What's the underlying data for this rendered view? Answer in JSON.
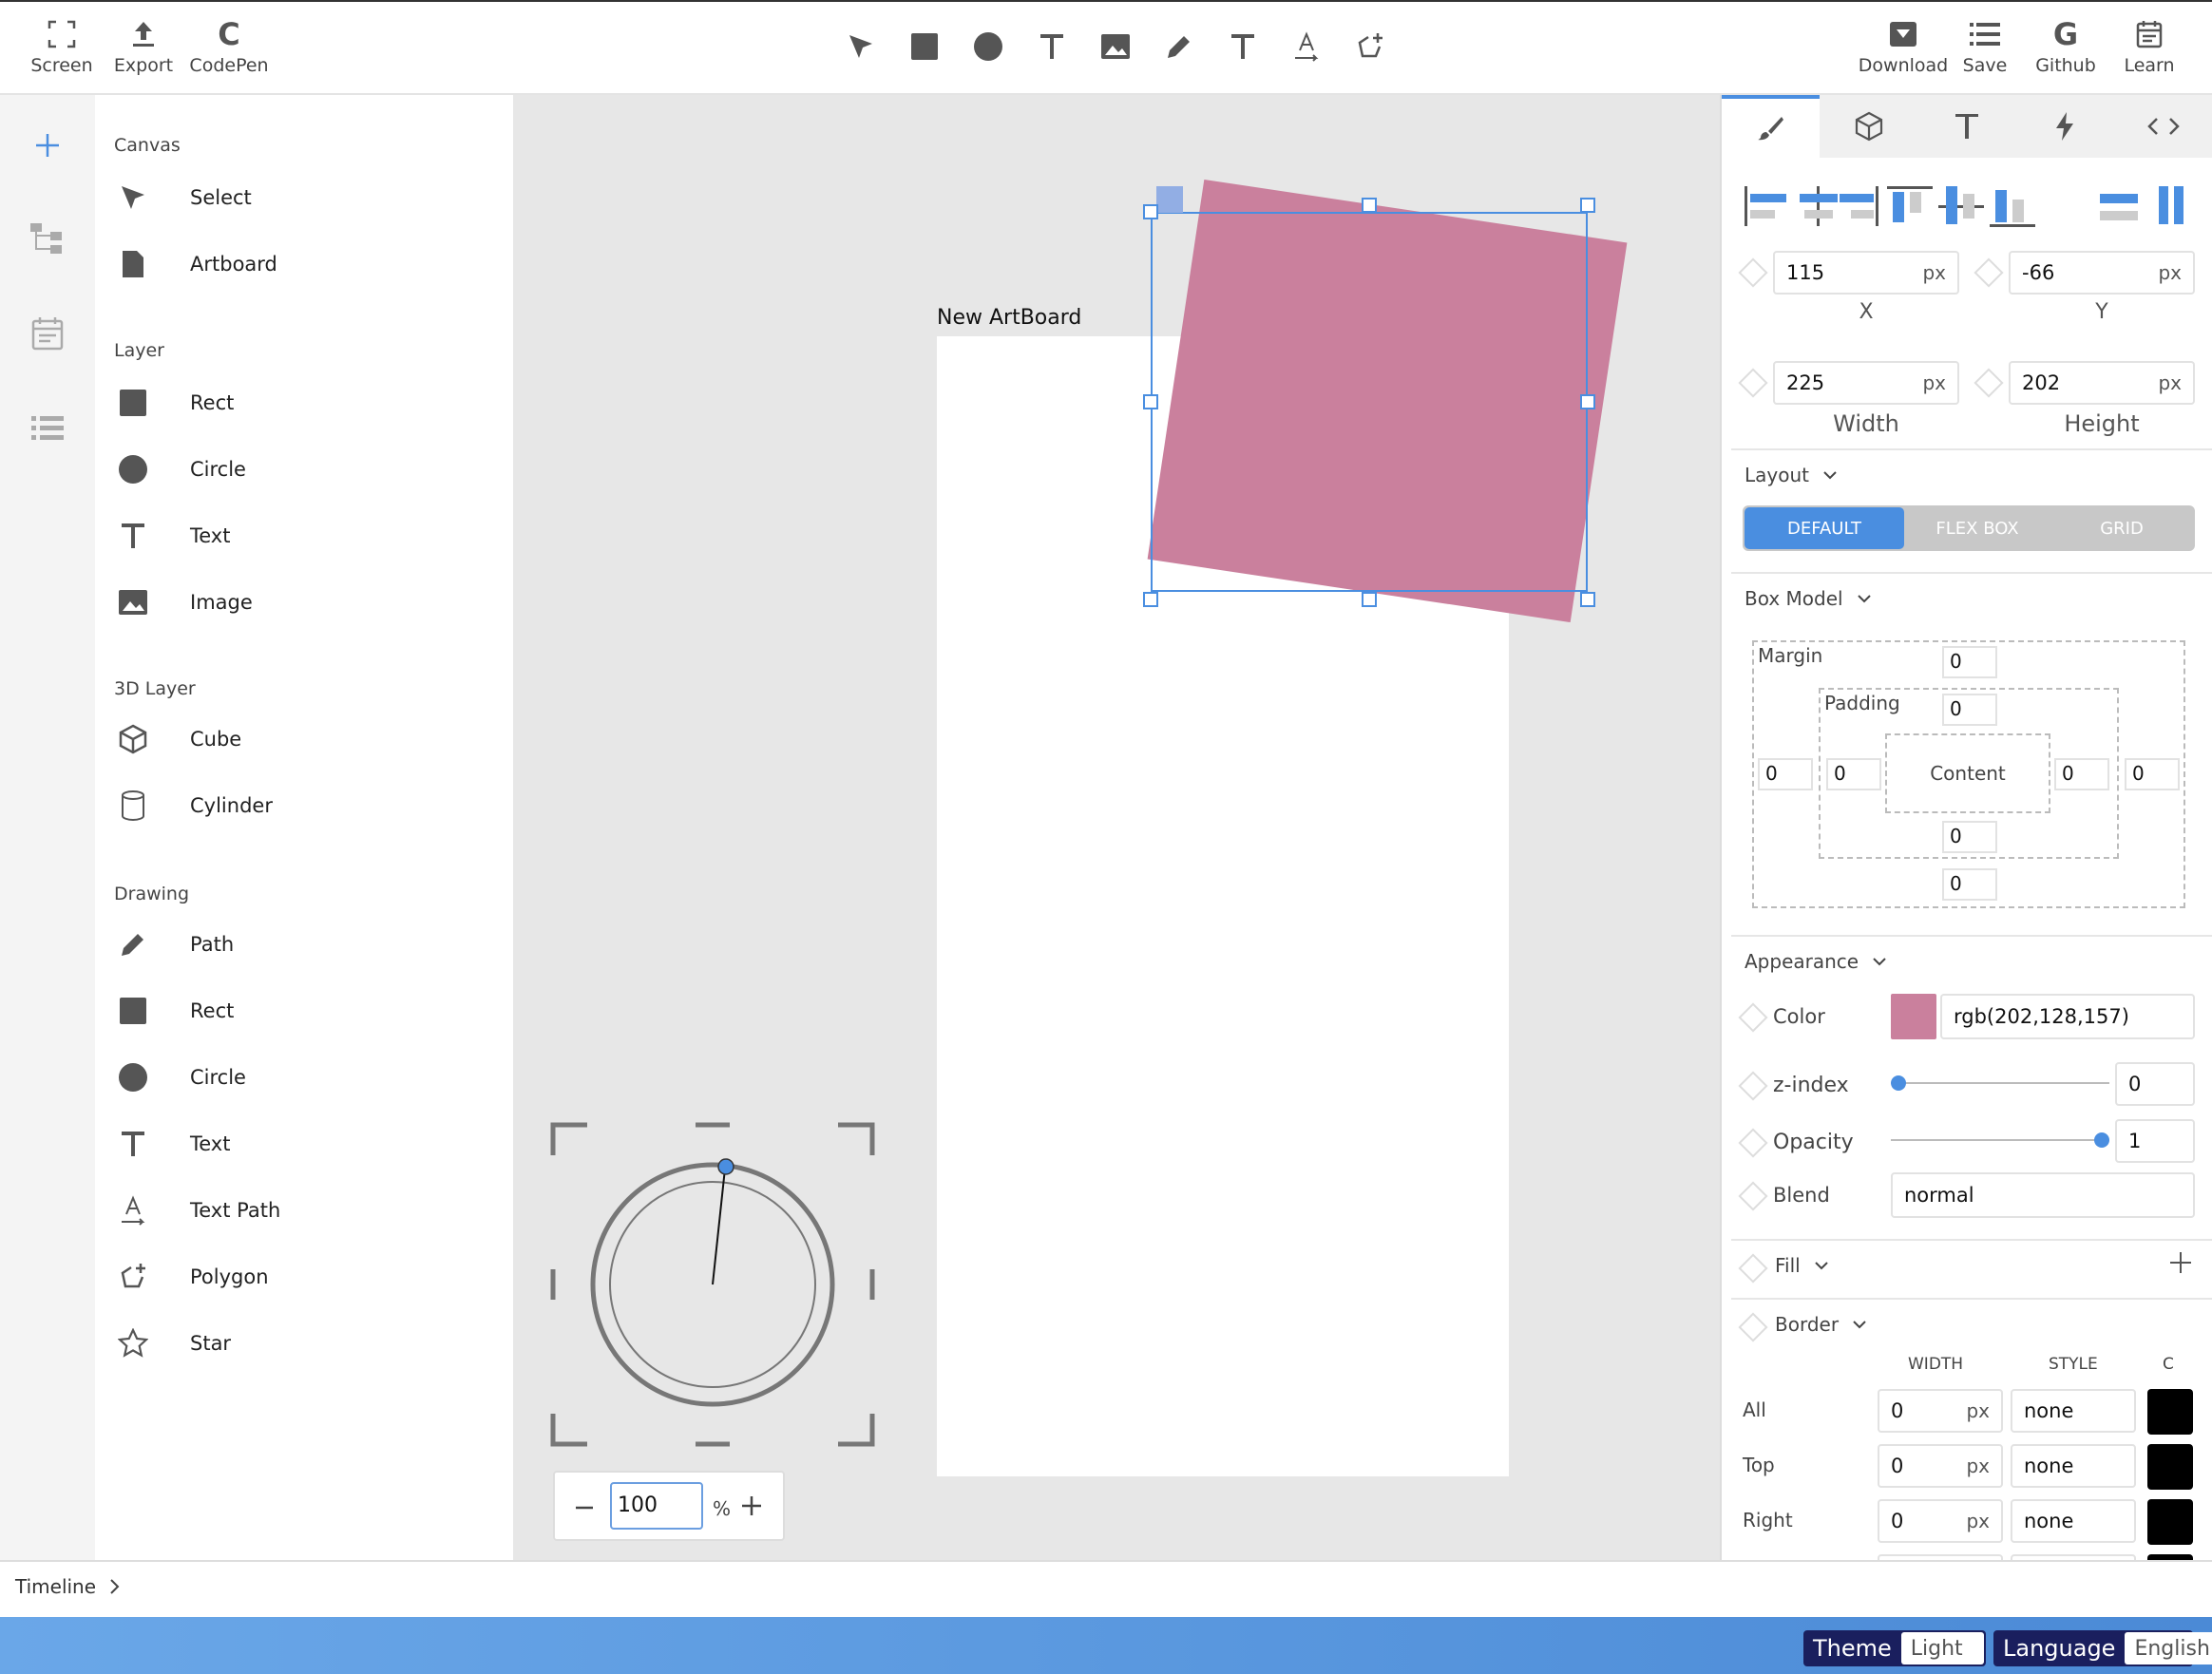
{
  "topbar": {
    "left_buttons": [
      {
        "label": "Screen",
        "icon": "fullscreen-icon"
      },
      {
        "label": "Export",
        "icon": "export-icon"
      },
      {
        "label": "CodePen",
        "icon": "codepen-icon"
      }
    ],
    "tools": [
      "select-arrow-icon",
      "rect-icon",
      "circle-icon",
      "text-icon",
      "image-icon",
      "pencil-icon",
      "text-icon",
      "text-path-icon",
      "polygon-icon"
    ],
    "right_buttons": [
      {
        "label": "Download",
        "icon": "download-icon"
      },
      {
        "label": "Save",
        "icon": "save-list-icon"
      },
      {
        "label": "Github",
        "icon": "github-icon"
      },
      {
        "label": "Learn",
        "icon": "calendar-icon"
      }
    ]
  },
  "panel": {
    "sections": [
      {
        "title": "Canvas",
        "items": [
          "Select",
          "Artboard"
        ]
      },
      {
        "title": "Layer",
        "items": [
          "Rect",
          "Circle",
          "Text",
          "Image"
        ]
      },
      {
        "title": "3D Layer",
        "items": [
          "Cube",
          "Cylinder"
        ]
      },
      {
        "title": "Drawing",
        "items": [
          "Path",
          "Rect",
          "Circle",
          "Text",
          "Text Path",
          "Polygon",
          "Star"
        ]
      }
    ]
  },
  "canvas": {
    "artboard_title": "New ArtBoard",
    "zoom_value": "100",
    "zoom_unit": "%",
    "shape_color": "#ca809d",
    "accent": "#4a8ee0"
  },
  "props": {
    "x": {
      "value": "115",
      "unit": "px",
      "caption": "X"
    },
    "y": {
      "value": "-66",
      "unit": "px",
      "caption": "Y"
    },
    "width": {
      "value": "225",
      "unit": "px",
      "caption": "Width"
    },
    "height": {
      "value": "202",
      "unit": "px",
      "caption": "Height"
    },
    "layout": {
      "title": "Layout",
      "options": [
        "DEFAULT",
        "FLEX BOX",
        "GRID"
      ],
      "selected": "DEFAULT"
    },
    "box_model": {
      "title": "Box Model",
      "margin_label": "Margin",
      "padding_label": "Padding",
      "content_label": "Content",
      "margin": {
        "top": "0",
        "right": "0",
        "bottom": "0",
        "left": "0"
      },
      "padding": {
        "top": "0",
        "right": "0",
        "bottom": "0",
        "left": "0"
      }
    },
    "appearance": {
      "title": "Appearance",
      "color_label": "Color",
      "color_value": "rgb(202,128,157)",
      "zindex_label": "z-index",
      "zindex_value": "0",
      "zindex_level": 0,
      "opacity_label": "Opacity",
      "opacity_value": "1",
      "opacity_level": 1,
      "blend_label": "Blend",
      "blend_value": "normal"
    },
    "fill": {
      "title": "Fill"
    },
    "border": {
      "title": "Border",
      "col_width": "WIDTH",
      "col_style": "STYLE",
      "col_color": "C",
      "rows": [
        {
          "label": "All",
          "width": "0",
          "unit": "px",
          "style": "none"
        },
        {
          "label": "Top",
          "width": "0",
          "unit": "px",
          "style": "none"
        },
        {
          "label": "Right",
          "width": "0",
          "unit": "px",
          "style": "none"
        }
      ]
    }
  },
  "timeline": {
    "label": "Timeline"
  },
  "status": {
    "theme_label": "Theme",
    "theme_value": "Light",
    "language_label": "Language",
    "language_value": "English"
  }
}
